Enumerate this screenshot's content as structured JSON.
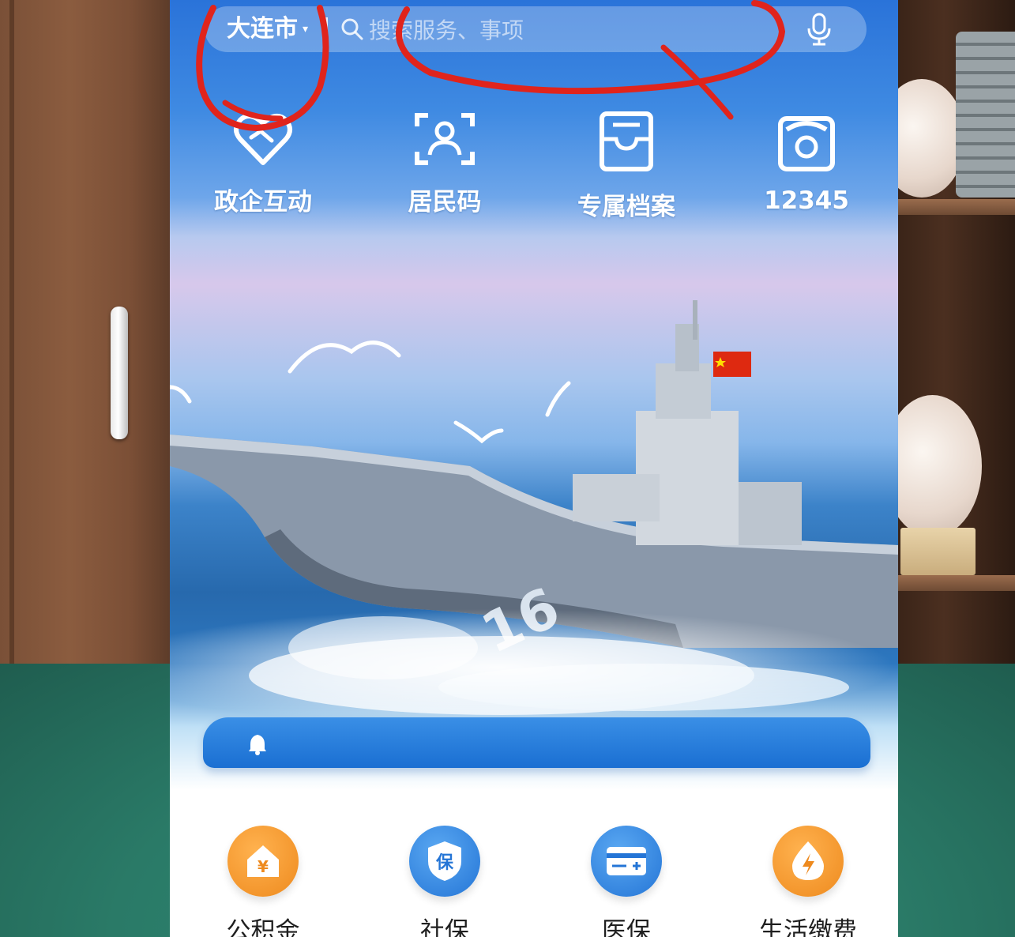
{
  "search_bar": {
    "city": "大连市",
    "placeholder": "搜索服务、事项"
  },
  "quick_services": [
    {
      "label": "政企互动",
      "icon": "heart-handshake-icon"
    },
    {
      "label": "居民码",
      "icon": "face-scan-icon"
    },
    {
      "label": "专属档案",
      "icon": "archive-box-icon"
    },
    {
      "label": "12345",
      "icon": "hotline-phone-icon"
    }
  ],
  "notice_bar": {
    "icon": "bell-icon",
    "text": ""
  },
  "services": [
    {
      "label": "公积金",
      "icon": "housing-fund-icon",
      "color": "#f0922b"
    },
    {
      "label": "社保",
      "icon": "social-security-shield-icon",
      "color": "#2f86de"
    },
    {
      "label": "医保",
      "icon": "medical-card-icon",
      "color": "#2f86de"
    },
    {
      "label": "生活缴费",
      "icon": "utility-payment-icon",
      "color": "#f0922b"
    }
  ],
  "colors": {
    "header_blue": "#2a73d9",
    "annotation_red": "#e0241c",
    "notice_blue": "#1a6fd2"
  }
}
